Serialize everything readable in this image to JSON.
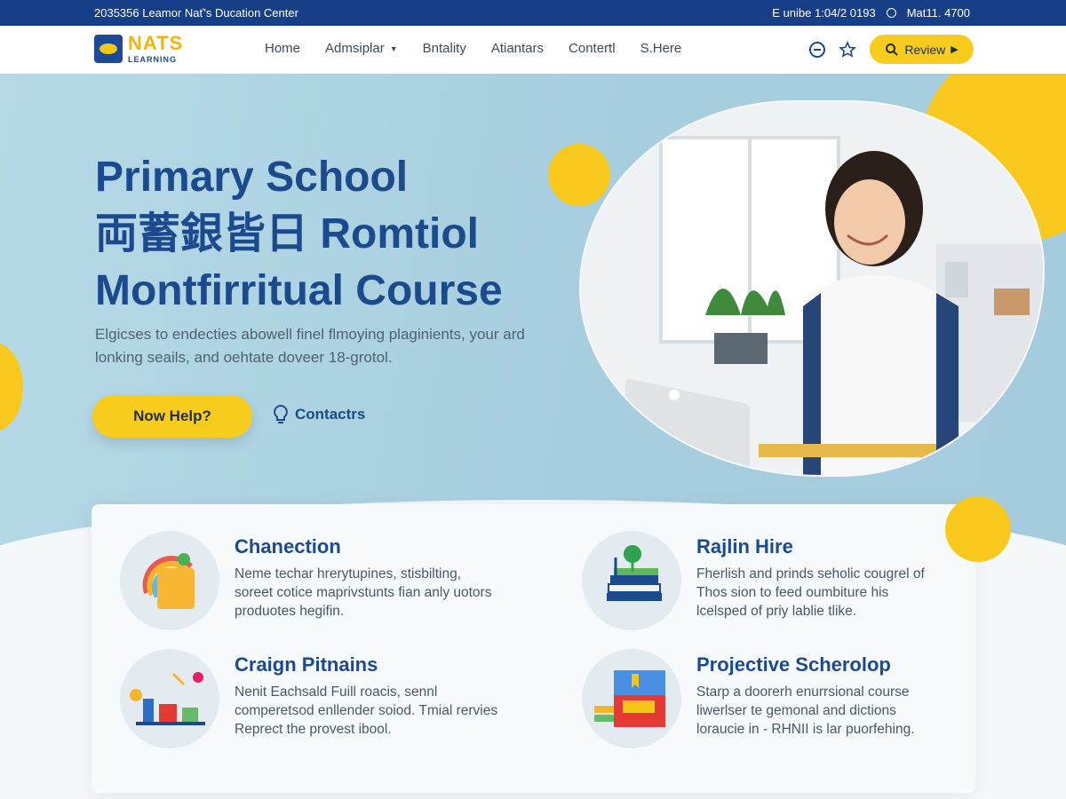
{
  "topbar": {
    "left_text": "2035356 Leamor Nať's Ducation Center",
    "right_text_1": "E unibe 1:04/2 0193",
    "right_text_2": "Mat11. 4700"
  },
  "nav": {
    "logo": {
      "line1": "NATS",
      "line2": "LEARNING"
    },
    "items": [
      {
        "label": "Home"
      },
      {
        "label": "Admsiplar",
        "has_dropdown": true
      },
      {
        "label": "Bntality"
      },
      {
        "label": "Atiantars"
      },
      {
        "label": "Contertl"
      },
      {
        "label": "S.Here"
      }
    ],
    "review_button": "Review"
  },
  "hero": {
    "title_lines": [
      "Primary School",
      "両蓄銀皆日 Romtiol",
      "Montfirritual Course"
    ],
    "description_lines": [
      "Elgicses to endecties abowell finel flmoying plaginients, your ard",
      "lonking seails, and oehtate doveer 18-grotol."
    ],
    "primary_cta": "Now Help?",
    "secondary_cta": "Contactrs"
  },
  "features": [
    {
      "title": "Chanection",
      "lines": [
        "Neme techar hrerytupines, stisbilting,",
        "soreet cotice maprivstunts fian anly uotors",
        "produotes hegifin."
      ]
    },
    {
      "title": "Rajlin Hire",
      "lines": [
        "Fherlish and prinds seholic cougrel of",
        "Thos sion to feed oumbiture his",
        "lcelsped of priy lablie tlike."
      ]
    },
    {
      "title": "Craign Pitnains",
      "lines": [
        "Nenit Eachsald Fuill roacis, sennl",
        "comperetsod enllender soiod. Tmial rervies",
        "Reprect the provest ibool."
      ]
    },
    {
      "title": "Projective Scherolop",
      "lines": [
        "Starp a doorerh enurrsional course",
        "liwerlser te gemonal and dictions",
        "loraucie in - RHNII is lar puorfehing."
      ]
    }
  ],
  "colors": {
    "primary_blue": "#163f88",
    "heading_blue": "#1b4a8e",
    "accent_yellow": "#f7cc1d",
    "hero_bg": "#a9d0e0"
  }
}
